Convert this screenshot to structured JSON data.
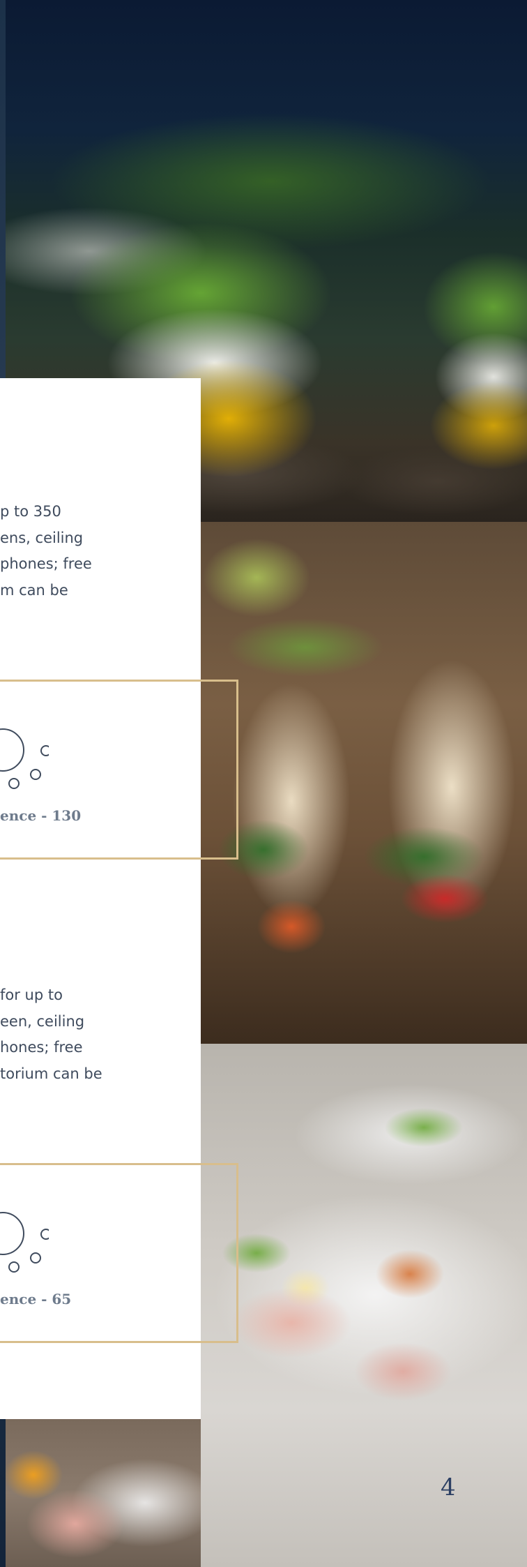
{
  "rooms": [
    {
      "description": "p to 350\nens, ceiling\nphones; free\nm can be",
      "capacity_label": "ence - 130"
    },
    {
      "description": "for up to\neen, ceiling\nhones; free\ntorium can be",
      "capacity_label": "ence - 65"
    }
  ],
  "page_number": "4",
  "colors": {
    "accent_gold": "#d8be8c",
    "text": "#3f4b5d",
    "label": "#6e7b8c",
    "navy": "#0b1a33"
  },
  "icons": [
    "table-seating-layout-icon",
    "table-seating-layout-icon"
  ]
}
